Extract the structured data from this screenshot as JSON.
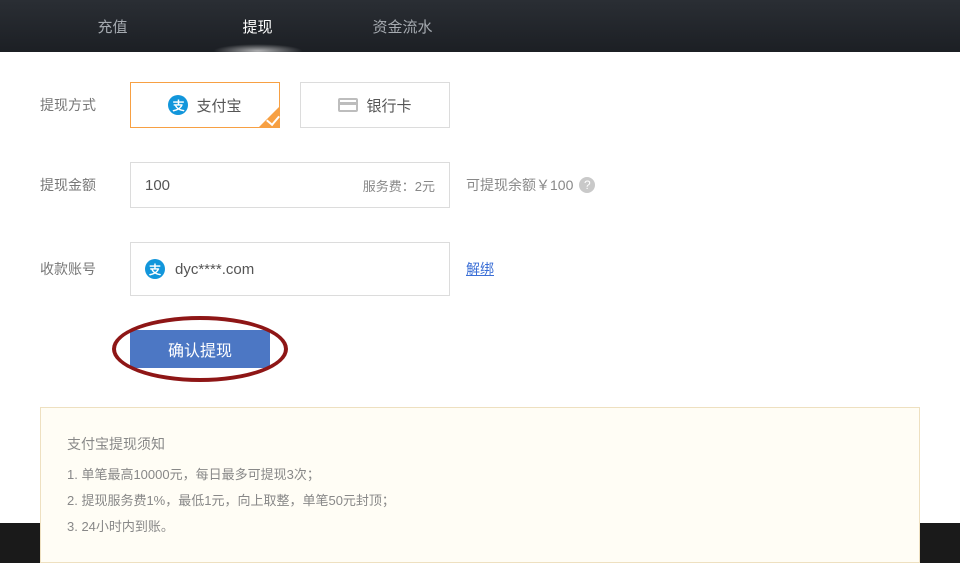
{
  "tabs": {
    "recharge": "充值",
    "withdraw": "提现",
    "flow": "资金流水"
  },
  "labels": {
    "method": "提现方式",
    "amount": "提现金额",
    "account": "收款账号"
  },
  "methods": {
    "alipay": {
      "label": "支付宝",
      "badge": "支"
    },
    "bank": {
      "label": "银行卡"
    }
  },
  "amount": {
    "value": "100",
    "fee_label": "服务费：2元"
  },
  "balance": {
    "text": "可提现余额￥100"
  },
  "account": {
    "value": "dyc****.com",
    "unbind": "解绑"
  },
  "submit": {
    "label": "确认提现"
  },
  "notice": {
    "title": "支付宝提现须知",
    "line1": "1. 单笔最高10000元，每日最多可提现3次；",
    "line2": "2. 提现服务费1%，最低1元，向上取整，单笔50元封顶；",
    "line3": "3. 24小时内到账。"
  }
}
